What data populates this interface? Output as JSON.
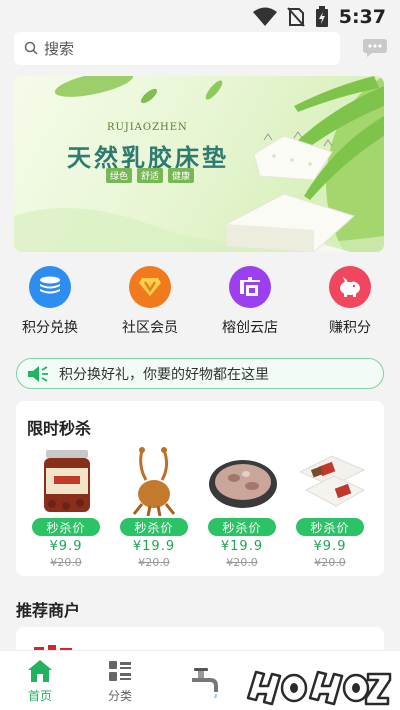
{
  "status_bar": {
    "time": "5:37",
    "icons": [
      "wifi-icon",
      "no-sim-icon",
      "battery-charging-icon"
    ]
  },
  "search": {
    "placeholder": "搜索",
    "chat_icon": "chat-bubble-icon"
  },
  "banner": {
    "subtitle": "RUJIAOZHEN",
    "title": "天然乳胶床垫",
    "tags": [
      "绿色",
      "舒适",
      "健康"
    ]
  },
  "quick_entries": [
    {
      "label": "积分兑换",
      "icon": "coins-stack-icon",
      "color": "#2d8df0"
    },
    {
      "label": "社区会员",
      "icon": "vip-v-icon",
      "color": "#f07a1c"
    },
    {
      "label": "榕创云店",
      "icon": "store-icon",
      "color": "#9b3ff0"
    },
    {
      "label": "赚积分",
      "icon": "piggy-bank-icon",
      "color": "#f0465e"
    }
  ],
  "notice": {
    "text": "积分换好礼，你要的好物都在这里",
    "icon": "speaker-icon"
  },
  "flash_sale": {
    "title": "限时秒杀",
    "items": [
      {
        "badge": "秒杀价",
        "price": "¥9.9",
        "original_price": "¥20.0",
        "image": "jar-product"
      },
      {
        "badge": "秒杀价",
        "price": "¥19.9",
        "original_price": "¥20.0",
        "image": "roast-duck-product"
      },
      {
        "badge": "秒杀价",
        "price": "¥19.9",
        "original_price": "¥20.0",
        "image": "bowl-dish-product"
      },
      {
        "badge": "秒杀价",
        "price": "¥9.9",
        "original_price": "¥20.0",
        "image": "boxed-goods-product"
      }
    ]
  },
  "merchants": {
    "title": "推荐商户"
  },
  "tab_bar": {
    "tabs": [
      {
        "label": "首页",
        "icon": "home-icon",
        "active": true
      },
      {
        "label": "分类",
        "icon": "category-icon",
        "active": false
      }
    ]
  },
  "colors": {
    "accent": "#22b35e",
    "background": "#f3f3f3",
    "strike": "#999999"
  }
}
